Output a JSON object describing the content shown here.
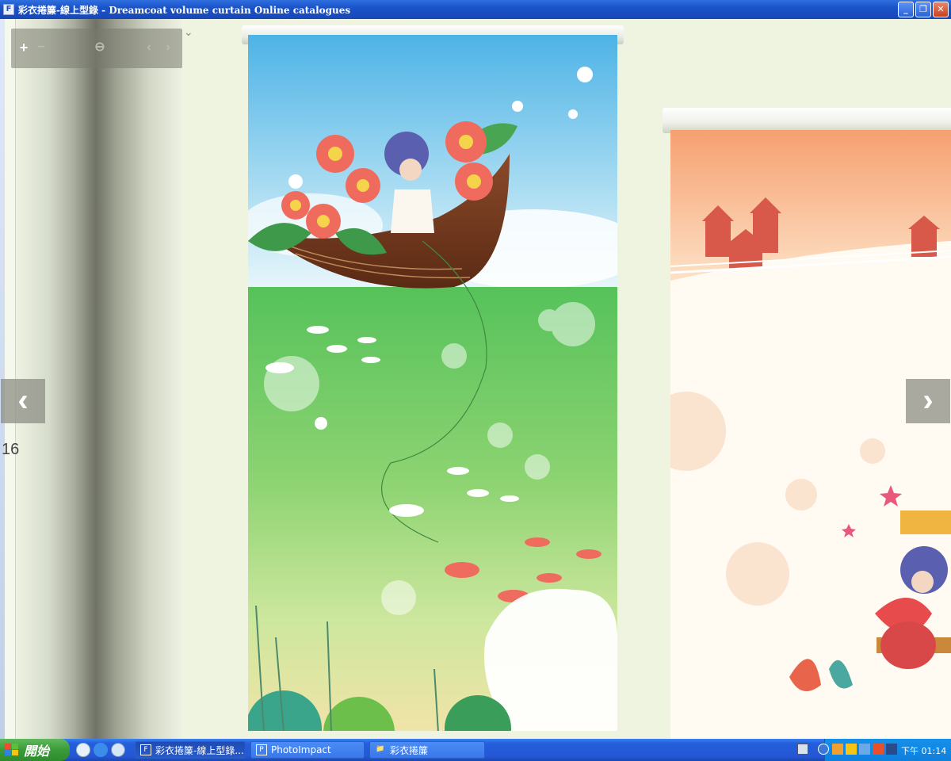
{
  "window": {
    "title": "彩衣捲簾-線上型錄 - Dreamcoat volume curtain Online catalogues",
    "app_icon": "F",
    "controls": {
      "minimize": "_",
      "restore": "❐",
      "close": "✕"
    }
  },
  "viewer": {
    "zoom_in": "+",
    "zoom_out": "−",
    "zoom_reset_icon": "⊖",
    "prev_small": "‹",
    "next_small": "›",
    "dropdown_icon": "⌄",
    "prev_page": "‹",
    "next_page": "›",
    "page_number": "16"
  },
  "taskbar": {
    "start_label": "開始",
    "items": [
      {
        "label": "彩衣捲簾-線上型錄...",
        "icon": "F",
        "active": true
      },
      {
        "label": "PhotoImpact",
        "icon": "P",
        "active": false
      },
      {
        "label": "彩衣捲簾",
        "icon": "📁",
        "active": false
      }
    ],
    "clock": "下午 01:14"
  },
  "colors": {
    "titlebar": "#1a53c8",
    "taskbar": "#245edb",
    "start": "#3a9a38",
    "page_bg": "#eef4e0"
  }
}
